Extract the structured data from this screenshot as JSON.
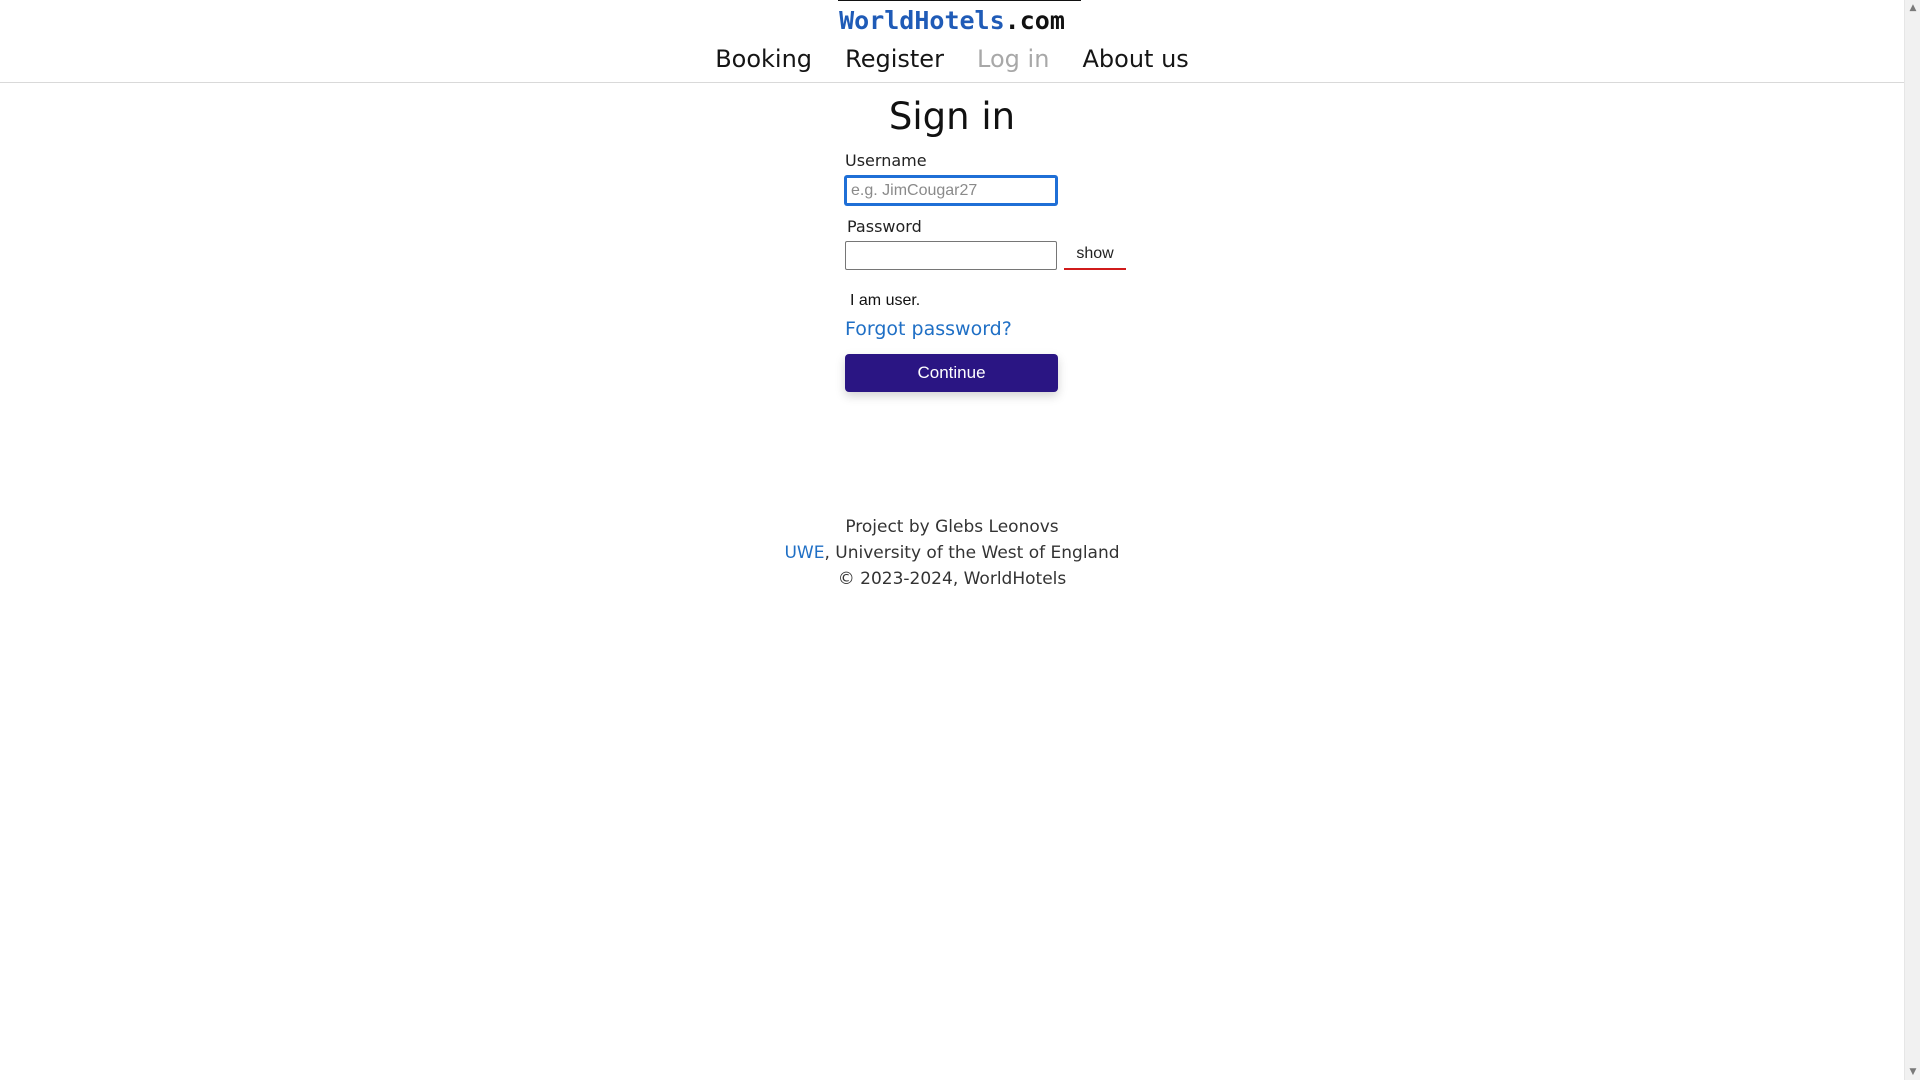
{
  "header": {
    "logo": {
      "brand": "WorldHotels",
      "tld": ".com"
    },
    "nav": [
      {
        "label": "Booking",
        "disabled": false
      },
      {
        "label": "Register",
        "disabled": false
      },
      {
        "label": "Log in",
        "disabled": true
      },
      {
        "label": "About us",
        "disabled": false
      }
    ]
  },
  "form": {
    "title": "Sign in",
    "username": {
      "label": "Username",
      "placeholder": "e.g. JimCougar27",
      "value": ""
    },
    "password": {
      "label": "Password",
      "value": "",
      "show_label": "show"
    },
    "role_text": "I am user.",
    "forgot_link": "Forgot password?",
    "submit_label": "Continue"
  },
  "footer": {
    "line1": "Project by Glebs Leonovs",
    "uwe_link": "UWE",
    "line2_rest": ", University of the West of England",
    "line3": "© 2023-2024, WorldHotels"
  },
  "colors": {
    "brand": "#1f5bb7",
    "link": "#1f6fc5",
    "button": "#2a1583",
    "show_underline": "#d01b1b",
    "focus": "#1f6fd6"
  },
  "icons": {
    "scroll_up": "scroll-up-arrow-icon",
    "scroll_down": "scroll-down-arrow-icon"
  }
}
